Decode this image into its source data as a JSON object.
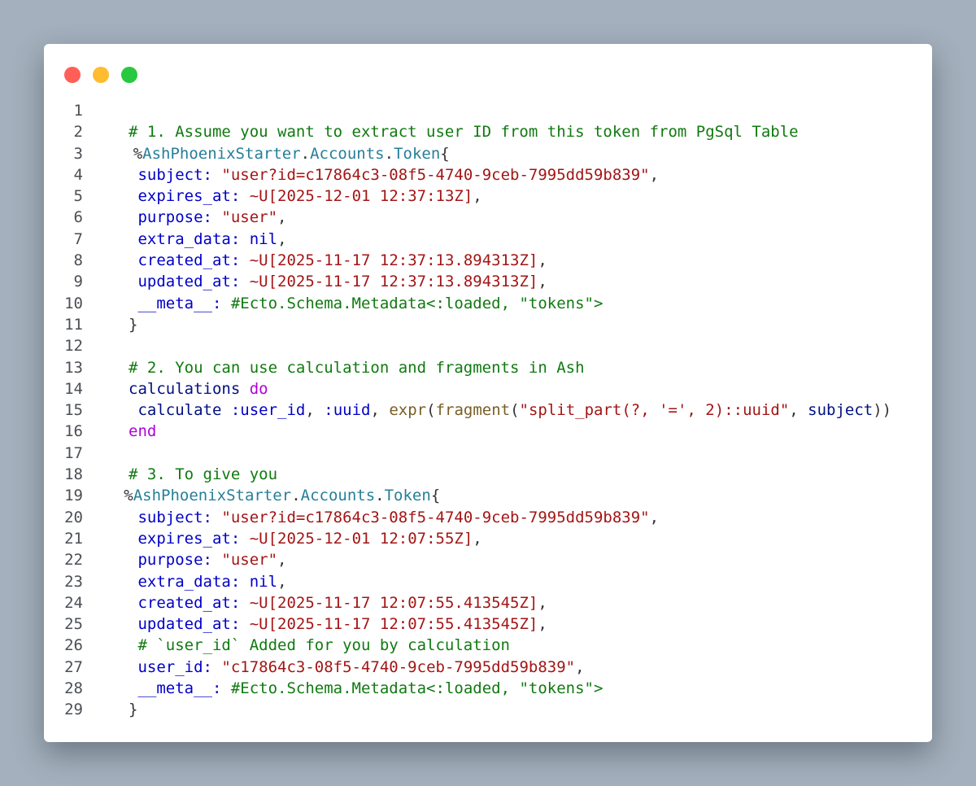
{
  "window": {
    "controls": [
      {
        "name": "close",
        "color": "#ff5f57"
      },
      {
        "name": "minimize",
        "color": "#febc2e"
      },
      {
        "name": "zoom",
        "color": "#28c840"
      }
    ]
  },
  "colors": {
    "background": "#a4b0bd",
    "comment": "#107a10",
    "key": "#0000c8",
    "string": "#a31515",
    "module": "#267f99",
    "keyword": "#af00db",
    "function": "#795e26",
    "variable": "#001080"
  },
  "code": {
    "lines": [
      {
        "n": "1",
        "indent": 0,
        "tokens": []
      },
      {
        "n": "2",
        "indent": 3,
        "tokens": [
          {
            "t": "comment",
            "v": "# 1. Assume you want to extract user ID from this token from PgSql Table"
          }
        ]
      },
      {
        "n": "3",
        "indent": 3.5,
        "tokens": [
          {
            "t": "punct",
            "v": "%"
          },
          {
            "t": "module",
            "v": "AshPhoenixStarter"
          },
          {
            "t": "punct",
            "v": "."
          },
          {
            "t": "module",
            "v": "Accounts"
          },
          {
            "t": "punct",
            "v": "."
          },
          {
            "t": "module",
            "v": "Token"
          },
          {
            "t": "punct",
            "v": "{"
          }
        ]
      },
      {
        "n": "4",
        "indent": 4,
        "tokens": [
          {
            "t": "key",
            "v": "subject:"
          },
          {
            "t": "punct",
            "v": " "
          },
          {
            "t": "string",
            "v": "\"user?id=c17864c3-08f5-4740-9ceb-7995dd59b839\""
          },
          {
            "t": "punct",
            "v": ","
          }
        ]
      },
      {
        "n": "5",
        "indent": 4,
        "tokens": [
          {
            "t": "key",
            "v": "expires_at:"
          },
          {
            "t": "punct",
            "v": " "
          },
          {
            "t": "sigil",
            "v": "~U[2025-12-01 12:37:13Z]"
          },
          {
            "t": "punct",
            "v": ","
          }
        ]
      },
      {
        "n": "6",
        "indent": 4,
        "tokens": [
          {
            "t": "key",
            "v": "purpose:"
          },
          {
            "t": "punct",
            "v": " "
          },
          {
            "t": "string",
            "v": "\"user\""
          },
          {
            "t": "punct",
            "v": ","
          }
        ]
      },
      {
        "n": "7",
        "indent": 4,
        "tokens": [
          {
            "t": "key",
            "v": "extra_data:"
          },
          {
            "t": "punct",
            "v": " "
          },
          {
            "t": "nil",
            "v": "nil"
          },
          {
            "t": "punct",
            "v": ","
          }
        ]
      },
      {
        "n": "8",
        "indent": 4,
        "tokens": [
          {
            "t": "key",
            "v": "created_at:"
          },
          {
            "t": "punct",
            "v": " "
          },
          {
            "t": "sigil",
            "v": "~U[2025-11-17 12:37:13.894313Z]"
          },
          {
            "t": "punct",
            "v": ","
          }
        ]
      },
      {
        "n": "9",
        "indent": 4,
        "tokens": [
          {
            "t": "key",
            "v": "updated_at:"
          },
          {
            "t": "punct",
            "v": " "
          },
          {
            "t": "sigil",
            "v": "~U[2025-11-17 12:37:13.894313Z]"
          },
          {
            "t": "punct",
            "v": ","
          }
        ]
      },
      {
        "n": "10",
        "indent": 4,
        "tokens": [
          {
            "t": "key",
            "v": "__meta__:"
          },
          {
            "t": "punct",
            "v": " "
          },
          {
            "t": "comment",
            "v": "#Ecto.Schema.Metadata<:loaded, \"tokens\">"
          }
        ]
      },
      {
        "n": "11",
        "indent": 3,
        "tokens": [
          {
            "t": "punct",
            "v": "}"
          }
        ]
      },
      {
        "n": "12",
        "indent": 0,
        "tokens": []
      },
      {
        "n": "13",
        "indent": 3,
        "tokens": [
          {
            "t": "comment",
            "v": "# 2. You can use calculation and fragments in Ash"
          }
        ]
      },
      {
        "n": "14",
        "indent": 3,
        "tokens": [
          {
            "t": "var",
            "v": "calculations"
          },
          {
            "t": "punct",
            "v": " "
          },
          {
            "t": "kw",
            "v": "do"
          }
        ]
      },
      {
        "n": "15",
        "indent": 4,
        "tokens": [
          {
            "t": "var",
            "v": "calculate"
          },
          {
            "t": "punct",
            "v": " "
          },
          {
            "t": "atom",
            "v": ":user_id"
          },
          {
            "t": "punct",
            "v": ", "
          },
          {
            "t": "atom",
            "v": ":uuid"
          },
          {
            "t": "punct",
            "v": ", "
          },
          {
            "t": "fn",
            "v": "expr"
          },
          {
            "t": "punct",
            "v": "("
          },
          {
            "t": "fn",
            "v": "fragment"
          },
          {
            "t": "punct",
            "v": "("
          },
          {
            "t": "string",
            "v": "\"split_part(?, '=', 2)::uuid\""
          },
          {
            "t": "punct",
            "v": ", "
          },
          {
            "t": "var",
            "v": "subject"
          },
          {
            "t": "punct",
            "v": "))"
          }
        ]
      },
      {
        "n": "16",
        "indent": 3,
        "tokens": [
          {
            "t": "kw",
            "v": "end"
          }
        ]
      },
      {
        "n": "17",
        "indent": 0,
        "tokens": []
      },
      {
        "n": "18",
        "indent": 3,
        "tokens": [
          {
            "t": "comment",
            "v": "# 3. To give you"
          }
        ]
      },
      {
        "n": "19",
        "indent": 2.5,
        "tokens": [
          {
            "t": "punct",
            "v": "%"
          },
          {
            "t": "module",
            "v": "AshPhoenixStarter"
          },
          {
            "t": "punct",
            "v": "."
          },
          {
            "t": "module",
            "v": "Accounts"
          },
          {
            "t": "punct",
            "v": "."
          },
          {
            "t": "module",
            "v": "Token"
          },
          {
            "t": "punct",
            "v": "{"
          }
        ]
      },
      {
        "n": "20",
        "indent": 4,
        "tokens": [
          {
            "t": "key",
            "v": "subject:"
          },
          {
            "t": "punct",
            "v": " "
          },
          {
            "t": "string",
            "v": "\"user?id=c17864c3-08f5-4740-9ceb-7995dd59b839\""
          },
          {
            "t": "punct",
            "v": ","
          }
        ]
      },
      {
        "n": "21",
        "indent": 4,
        "tokens": [
          {
            "t": "key",
            "v": "expires_at:"
          },
          {
            "t": "punct",
            "v": " "
          },
          {
            "t": "sigil",
            "v": "~U[2025-12-01 12:07:55Z]"
          },
          {
            "t": "punct",
            "v": ","
          }
        ]
      },
      {
        "n": "22",
        "indent": 4,
        "tokens": [
          {
            "t": "key",
            "v": "purpose:"
          },
          {
            "t": "punct",
            "v": " "
          },
          {
            "t": "string",
            "v": "\"user\""
          },
          {
            "t": "punct",
            "v": ","
          }
        ]
      },
      {
        "n": "23",
        "indent": 4,
        "tokens": [
          {
            "t": "key",
            "v": "extra_data:"
          },
          {
            "t": "punct",
            "v": " "
          },
          {
            "t": "nil",
            "v": "nil"
          },
          {
            "t": "punct",
            "v": ","
          }
        ]
      },
      {
        "n": "24",
        "indent": 4,
        "tokens": [
          {
            "t": "key",
            "v": "created_at:"
          },
          {
            "t": "punct",
            "v": " "
          },
          {
            "t": "sigil",
            "v": "~U[2025-11-17 12:07:55.413545Z]"
          },
          {
            "t": "punct",
            "v": ","
          }
        ]
      },
      {
        "n": "25",
        "indent": 4,
        "tokens": [
          {
            "t": "key",
            "v": "updated_at:"
          },
          {
            "t": "punct",
            "v": " "
          },
          {
            "t": "sigil",
            "v": "~U[2025-11-17 12:07:55.413545Z]"
          },
          {
            "t": "punct",
            "v": ","
          }
        ]
      },
      {
        "n": "26",
        "indent": 4,
        "tokens": [
          {
            "t": "comment",
            "v": "# `user_id` Added for you by calculation"
          }
        ]
      },
      {
        "n": "27",
        "indent": 4,
        "tokens": [
          {
            "t": "key",
            "v": "user_id:"
          },
          {
            "t": "punct",
            "v": " "
          },
          {
            "t": "string",
            "v": "\"c17864c3-08f5-4740-9ceb-7995dd59b839\""
          },
          {
            "t": "punct",
            "v": ","
          }
        ]
      },
      {
        "n": "28",
        "indent": 4,
        "tokens": [
          {
            "t": "key",
            "v": "__meta__:"
          },
          {
            "t": "punct",
            "v": " "
          },
          {
            "t": "comment",
            "v": "#Ecto.Schema.Metadata<:loaded, \"tokens\">"
          }
        ]
      },
      {
        "n": "29",
        "indent": 3,
        "tokens": [
          {
            "t": "punct",
            "v": "}"
          }
        ]
      }
    ]
  }
}
